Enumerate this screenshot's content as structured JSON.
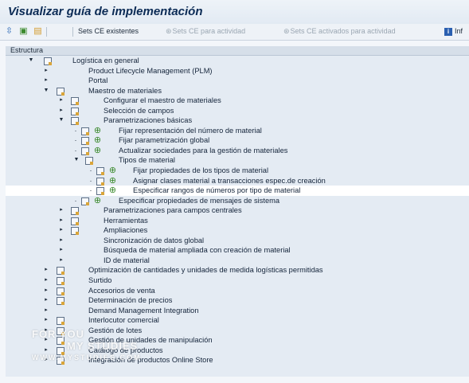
{
  "title": "Visualizar guía de implementación",
  "toolbar": {
    "sets_ce_existentes": "Sets CE existentes",
    "sets_ce_actividad": "Sets CE para actividad",
    "sets_ce_activados": "Sets CE activados para actividad",
    "info": "Inf"
  },
  "tree": {
    "column_header": "Estructura",
    "rows": [
      {
        "label": "Logística en general"
      },
      {
        "label": "Product Lifecycle Management (PLM)"
      },
      {
        "label": "Portal"
      },
      {
        "label": "Maestro de materiales"
      },
      {
        "label": "Configurar el maestro de materiales"
      },
      {
        "label": "Selección de campos"
      },
      {
        "label": "Parametrizaciones básicas"
      },
      {
        "label": "Fijar representación del número de material"
      },
      {
        "label": "Fijar parametrización global"
      },
      {
        "label": "Actualizar sociedades para la gestión de materiales"
      },
      {
        "label": "Tipos de material"
      },
      {
        "label": "Fijar propiedades de los tipos de material"
      },
      {
        "label": "Asignar clases material a transacciones espec.de creación"
      },
      {
        "label": "Especificar rangos de números por tipo de material"
      },
      {
        "label": "Especificar propiedades de mensajes de sistema"
      },
      {
        "label": "Parametrizaciones para campos centrales"
      },
      {
        "label": "Herramientas"
      },
      {
        "label": "Ampliaciones"
      },
      {
        "label": "Sincronización de datos global"
      },
      {
        "label": "Búsqueda de material ampliada con creación de material"
      },
      {
        "label": "ID de material"
      },
      {
        "label": "Optimización de cantidades y unidades de medida logísticas permitidas"
      },
      {
        "label": "Surtido"
      },
      {
        "label": "Accesorios de venta"
      },
      {
        "label": "Determinación de precios"
      },
      {
        "label": "Demand Management Integration"
      },
      {
        "label": "Interlocutor comercial"
      },
      {
        "label": "Gestión de lotes"
      },
      {
        "label": "Gestión de unidades de manipulación"
      },
      {
        "label": "Catálogo de productos"
      },
      {
        "label": "Integración de productos Online Store"
      }
    ]
  },
  "watermark": {
    "line1": "FOR YOU",
    "line2": "MY STUDIES",
    "line3": "WWW.MYSTUDIES.COM"
  }
}
